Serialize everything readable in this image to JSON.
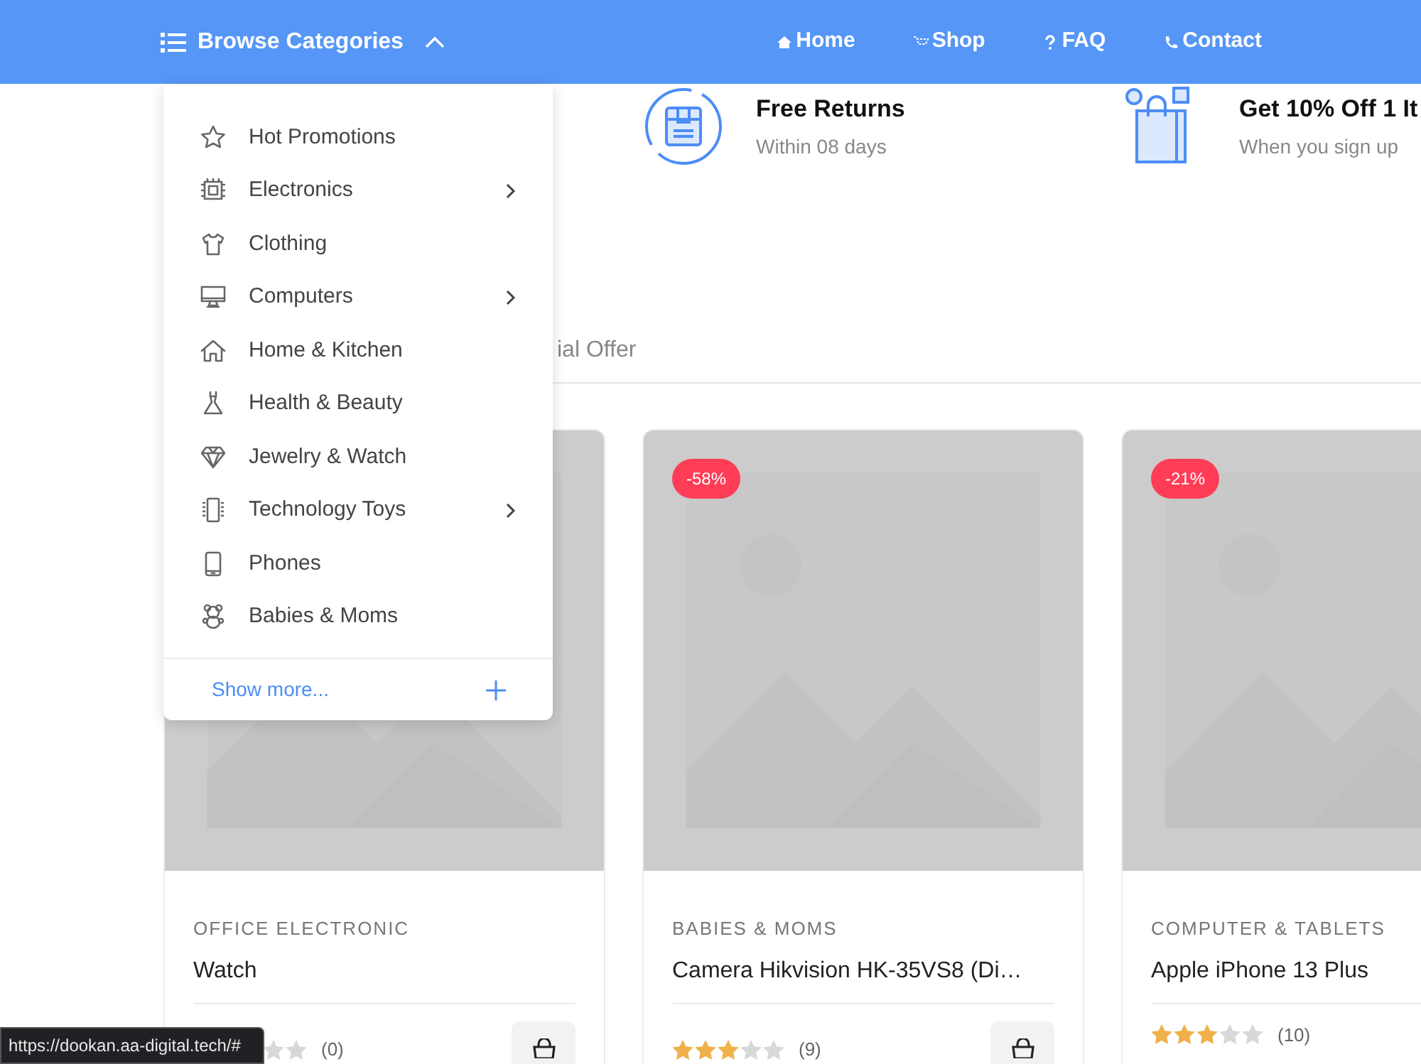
{
  "header": {
    "browse_label": "Browse Categories",
    "menu_open": true,
    "nav": [
      {
        "label": "Home"
      },
      {
        "label": "Shop"
      },
      {
        "label": "FAQ"
      },
      {
        "label": "Contact"
      }
    ]
  },
  "category_menu": {
    "items": [
      {
        "label": "Hot Promotions",
        "has_submenu": false
      },
      {
        "label": "Electronics",
        "has_submenu": true
      },
      {
        "label": "Clothing",
        "has_submenu": false
      },
      {
        "label": "Computers",
        "has_submenu": true
      },
      {
        "label": "Home & Kitchen",
        "has_submenu": false
      },
      {
        "label": "Health & Beauty",
        "has_submenu": false
      },
      {
        "label": "Jewelry & Watch",
        "has_submenu": false
      },
      {
        "label": "Technology Toys",
        "has_submenu": true
      },
      {
        "label": "Phones",
        "has_submenu": false
      },
      {
        "label": "Babies & Moms",
        "has_submenu": false
      }
    ],
    "show_more": "Show more..."
  },
  "features": [
    {
      "title": "Free Returns",
      "subtitle": "Within 08 days"
    },
    {
      "title": "Get 10% Off 1 It",
      "subtitle": "When you sign up"
    }
  ],
  "tabs": [
    {
      "label": "ial Offer",
      "selected": false
    }
  ],
  "products": [
    {
      "category": "OFFICE ELECTRONIC",
      "title": "Watch",
      "review_count": "(0)"
    },
    {
      "badge": "-58%",
      "category": "BABIES & MOMS",
      "title": "Camera Hikvision HK-35VS8 (Di…",
      "stars": 3,
      "review_count": "(9)"
    },
    {
      "badge": "-21%",
      "category": "COMPUTER & TABLETS",
      "title": "Apple iPhone 13 Plus",
      "stars": 3,
      "review_count": "(10)"
    }
  ],
  "status_url": "https://dookan.aa-digital.tech/#"
}
